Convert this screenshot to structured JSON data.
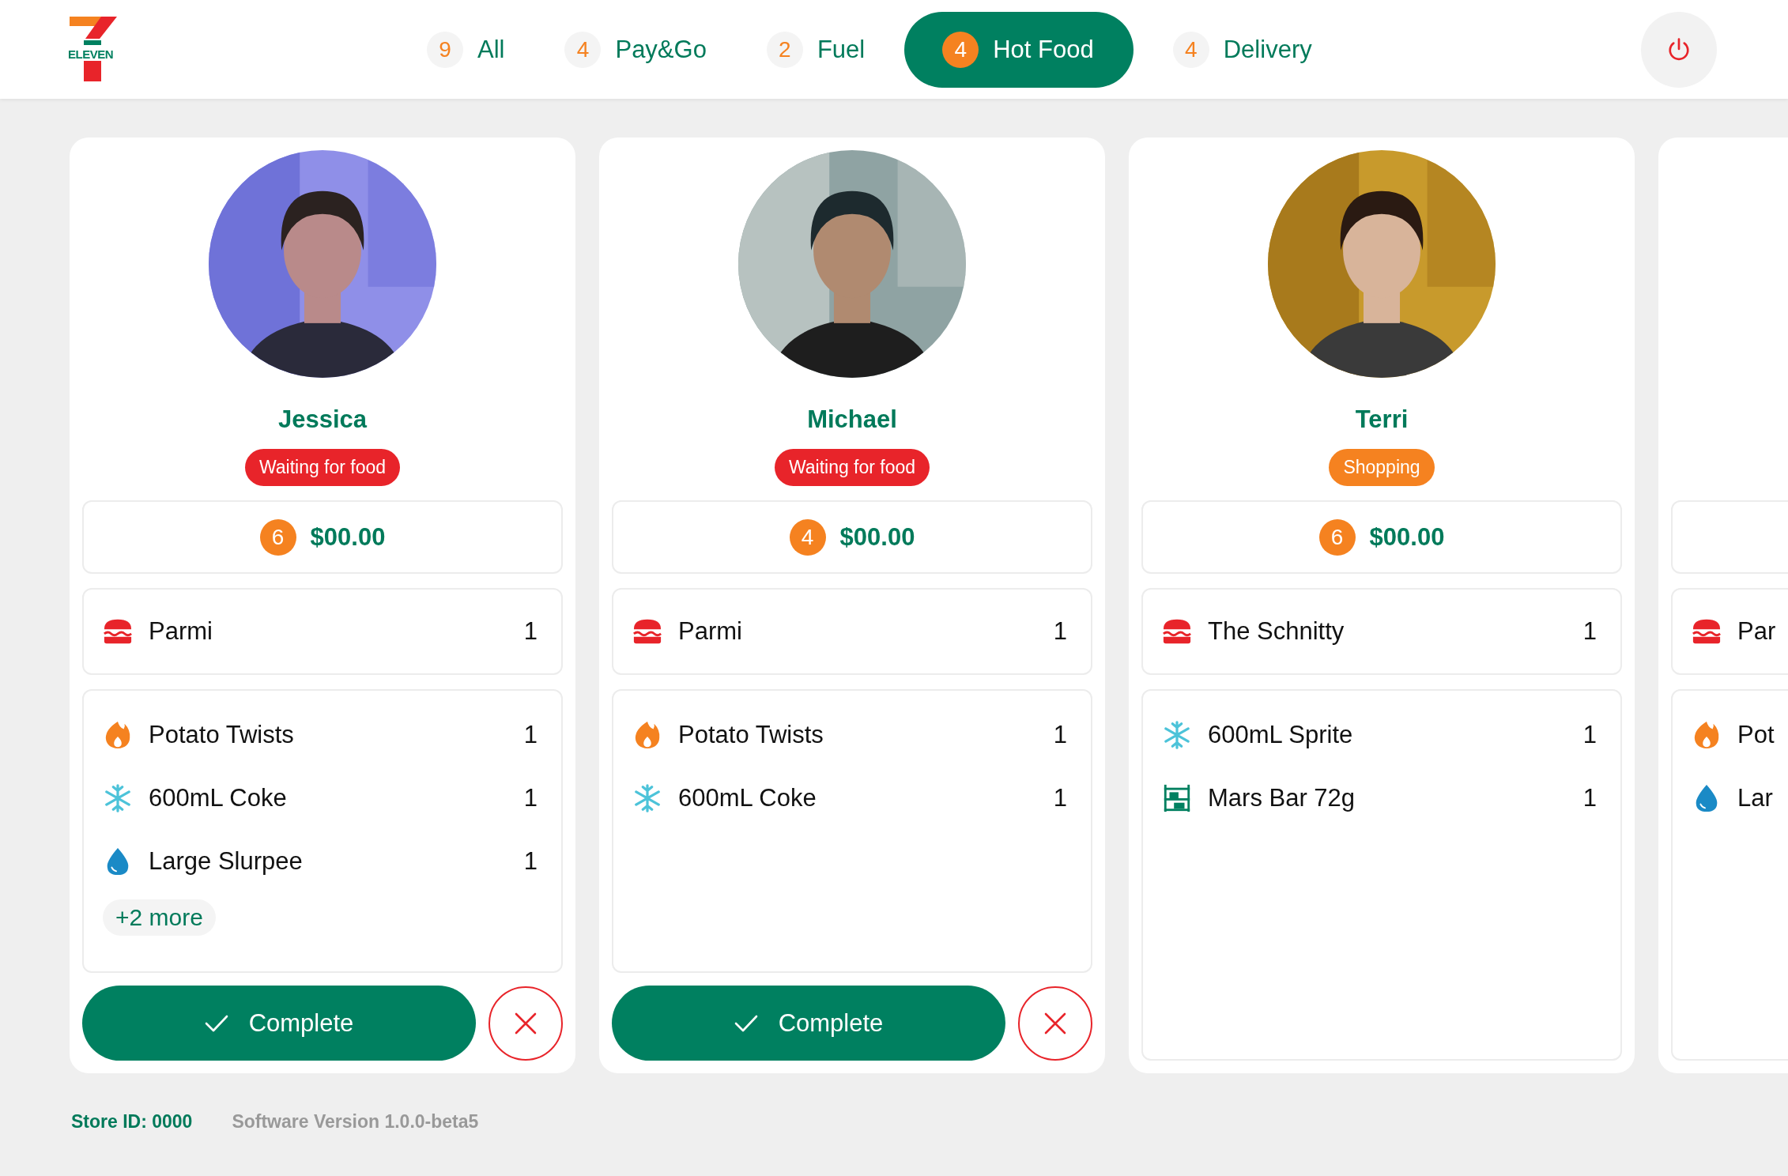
{
  "header": {
    "logo_text": "ELEVEN",
    "tabs": [
      {
        "count": "9",
        "label": "All",
        "selected": false
      },
      {
        "count": "4",
        "label": "Pay&Go",
        "selected": false
      },
      {
        "count": "2",
        "label": "Fuel",
        "selected": false
      },
      {
        "count": "4",
        "label": "Hot Food",
        "selected": true
      },
      {
        "count": "4",
        "label": "Delivery",
        "selected": false
      }
    ]
  },
  "cards": [
    {
      "photo": {
        "kind": "picture"
      },
      "name": "Jessica",
      "status": {
        "label": "Waiting for food",
        "color": "#e8242a"
      },
      "count": "6",
      "total": "$00.00",
      "main_items": [
        {
          "kind": "burger",
          "name": "Parmi",
          "qty": "1"
        }
      ],
      "other_items": [
        {
          "kind": "flame",
          "name": "Potato Twists",
          "qty": "1"
        },
        {
          "kind": "snowflake",
          "name": "600mL Coke",
          "qty": "1"
        },
        {
          "kind": "drop",
          "name": "Large Slurpee",
          "qty": "1"
        }
      ],
      "more": "+2 more",
      "complete_label": "Complete"
    },
    {
      "photo": {
        "kind": "picture"
      },
      "name": "Michael",
      "status": {
        "label": "Waiting for food",
        "color": "#e8242a"
      },
      "count": "4",
      "total": "$00.00",
      "main_items": [
        {
          "kind": "burger",
          "name": "Parmi",
          "qty": "1"
        }
      ],
      "other_items": [
        {
          "kind": "flame",
          "name": "Potato Twists",
          "qty": "1"
        },
        {
          "kind": "snowflake",
          "name": "600mL Coke",
          "qty": "1"
        }
      ],
      "complete_label": "Complete"
    },
    {
      "photo": {
        "kind": "picture"
      },
      "name": "Terri",
      "status": {
        "label": "Shopping",
        "color": "#f58220"
      },
      "count": "6",
      "total": "$00.00",
      "main_items": [
        {
          "kind": "burger",
          "name": "The Schnitty",
          "qty": "1"
        }
      ],
      "other_items": [
        {
          "kind": "snowflake",
          "name": "600mL Sprite",
          "qty": "1"
        },
        {
          "kind": "shelf",
          "name": "Mars Bar 72g",
          "qty": "1"
        }
      ]
    },
    {
      "main_items": [
        {
          "kind": "burger",
          "name": "Par"
        }
      ],
      "other_items": [
        {
          "kind": "flame",
          "name": "Pot"
        },
        {
          "kind": "drop",
          "name": "Lar"
        }
      ]
    }
  ],
  "footer": {
    "store_id": "Store ID: 0000",
    "version": "Software Version 1.0.0-beta5"
  }
}
